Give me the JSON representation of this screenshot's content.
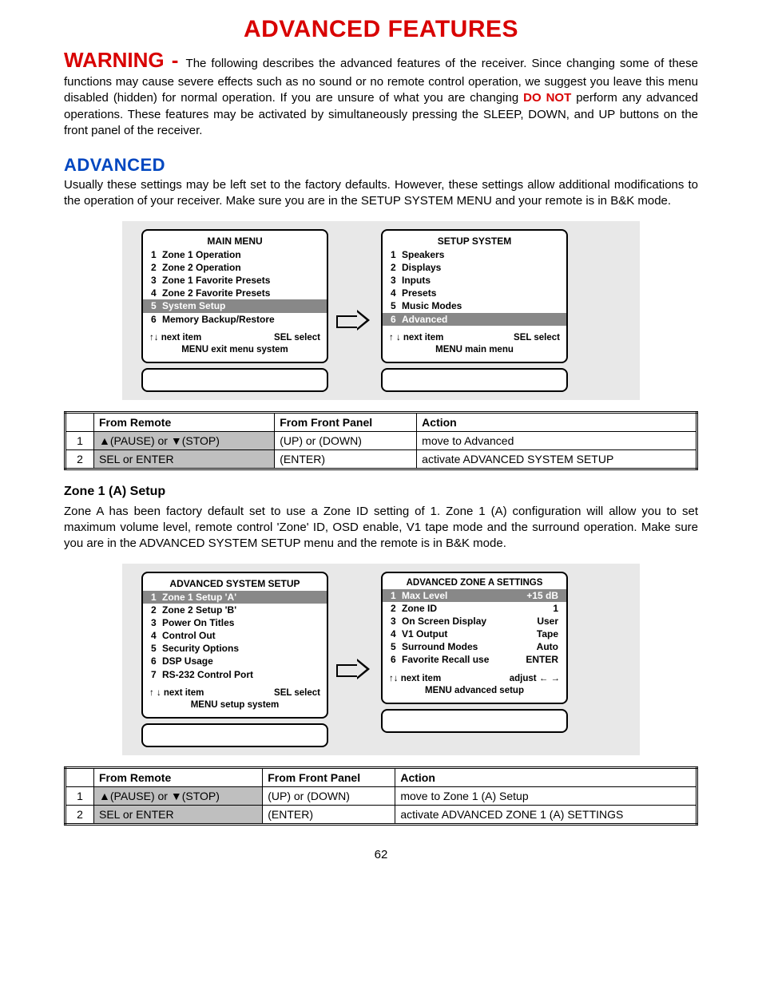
{
  "title": "ADVANCED FEATURES",
  "warning": {
    "label": "WARNING - ",
    "part1": "The following describes the advanced features of the receiver. Since changing some of these functions may cause severe effects such as no sound or no remote control operation, we suggest you leave this menu disabled (hidden) for normal operation. If you are unsure of what you are changing ",
    "doNot": "DO NOT",
    "part2": " perform any advanced operations. These features may be activated by simultaneously pressing the SLEEP, DOWN, and UP buttons on the front panel of the receiver."
  },
  "advanced": {
    "heading": "ADVANCED",
    "para": "Usually these settings may be left set to the factory defaults. However, these settings allow additional modifications to the operation of your receiver. Make sure you are in the SETUP SYSTEM MENU and your remote is in B&K mode."
  },
  "screens1": {
    "left": {
      "title": "MAIN MENU",
      "items": [
        {
          "n": "1",
          "label": "Zone 1 Operation",
          "selected": false
        },
        {
          "n": "2",
          "label": "Zone 2 Operation",
          "selected": false
        },
        {
          "n": "3",
          "label": "Zone 1 Favorite Presets",
          "selected": false
        },
        {
          "n": "4",
          "label": "Zone 2 Favorite Presets",
          "selected": false
        },
        {
          "n": "5",
          "label": "System Setup",
          "selected": true
        },
        {
          "n": "6",
          "label": "Memory Backup/Restore",
          "selected": false
        }
      ],
      "footerA_left": "↑↓ next item",
      "footerA_right": "SEL  select",
      "footerB": "MENU   exit menu system"
    },
    "right": {
      "title": "SETUP SYSTEM",
      "items": [
        {
          "n": "1",
          "label": "Speakers",
          "selected": false
        },
        {
          "n": "2",
          "label": "Displays",
          "selected": false
        },
        {
          "n": "3",
          "label": "Inputs",
          "selected": false
        },
        {
          "n": "4",
          "label": "Presets",
          "selected": false
        },
        {
          "n": "5",
          "label": "Music Modes",
          "selected": false
        },
        {
          "n": "6",
          "label": "Advanced",
          "selected": true
        }
      ],
      "footerA_left": "↑ ↓    next item",
      "footerA_right": "SEL  select",
      "footerB": "MENU main menu"
    }
  },
  "table1": {
    "headers": {
      "remote": "From Remote",
      "panel": "From Front Panel",
      "action": "Action"
    },
    "rows": [
      {
        "n": "1",
        "remote": "▲(PAUSE) or ▼(STOP)",
        "remoteHl": true,
        "panel": "(UP) or (DOWN)",
        "action": "move to Advanced"
      },
      {
        "n": "2",
        "remote": "SEL or ENTER",
        "remoteHl": true,
        "panel": "(ENTER)",
        "action": "activate ADVANCED SYSTEM SETUP"
      }
    ]
  },
  "zone1": {
    "heading": "Zone 1 (A) Setup",
    "para": "Zone A has been factory default set to use a Zone ID setting of 1. Zone 1 (A) configuration will allow you to set maximum volume level, remote control 'Zone' ID, OSD enable, V1 tape mode and the surround operation. Make sure you are in the ADVANCED SYSTEM SETUP menu and the remote is in B&K mode."
  },
  "screens2": {
    "left": {
      "title": "ADVANCED SYSTEM SETUP",
      "items": [
        {
          "n": "1",
          "label": "Zone 1  Setup 'A'",
          "selected": true
        },
        {
          "n": "2",
          "label": "Zone 2  Setup 'B'",
          "selected": false
        },
        {
          "n": "3",
          "label": "Power On Titles",
          "selected": false
        },
        {
          "n": "4",
          "label": "Control  Out",
          "selected": false
        },
        {
          "n": "5",
          "label": "Security Options",
          "selected": false
        },
        {
          "n": "6",
          "label": "DSP Usage",
          "selected": false
        },
        {
          "n": "7",
          "label": "RS-232  Control Port",
          "selected": false
        }
      ],
      "footerA_left": "↑ ↓    next item",
      "footerA_right": "SEL  select",
      "footerB": "MENU setup system"
    },
    "right": {
      "title": "ADVANCED ZONE A SETTINGS",
      "items": [
        {
          "n": "1",
          "label": "Max Level",
          "val": "+15 dB",
          "selected": true
        },
        {
          "n": "2",
          "label": "Zone ID",
          "val": "1",
          "selected": false
        },
        {
          "n": "3",
          "label": "On Screen Display",
          "val": "User",
          "selected": false
        },
        {
          "n": "4",
          "label": "V1 Output",
          "val": "Tape",
          "selected": false
        },
        {
          "n": "5",
          "label": "Surround Modes",
          "val": "Auto",
          "selected": false
        },
        {
          "n": "6",
          "label": "Favorite Recall use",
          "val": "ENTER",
          "selected": false
        }
      ],
      "footerA_left": "↑↓    next item",
      "footerA_right": "adjust ← →",
      "footerB": "MENU  advanced setup"
    }
  },
  "table2": {
    "headers": {
      "remote": "From Remote",
      "panel": "From Front Panel",
      "action": "Action"
    },
    "rows": [
      {
        "n": "1",
        "remote": "▲(PAUSE) or ▼(STOP)",
        "remoteHl": true,
        "panel": "(UP) or (DOWN)",
        "action": "move to Zone 1 (A) Setup"
      },
      {
        "n": "2",
        "remote": "SEL or ENTER",
        "remoteHl": true,
        "panel": "(ENTER)",
        "action": "activate ADVANCED ZONE 1 (A) SETTINGS"
      }
    ]
  },
  "pageNumber": "62"
}
